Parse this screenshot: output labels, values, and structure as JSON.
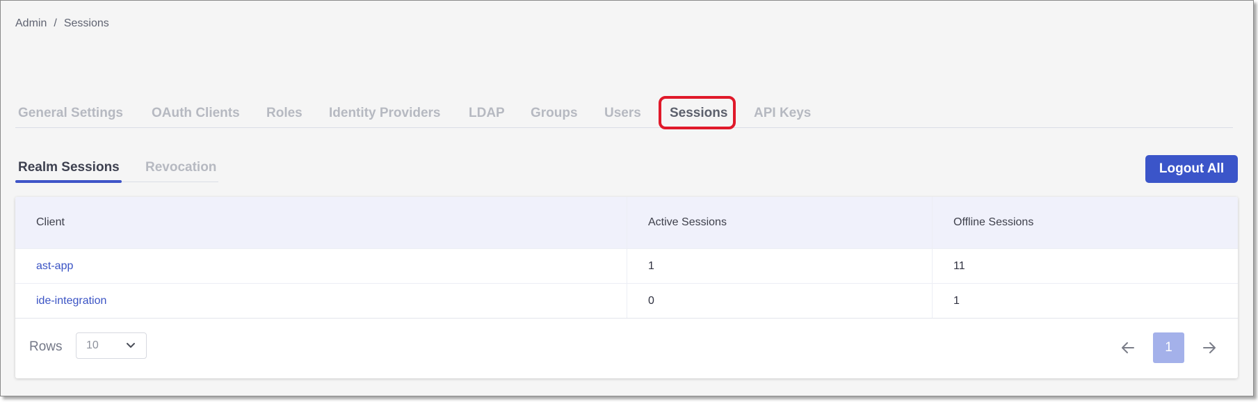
{
  "breadcrumb": {
    "root": "Admin",
    "separator": "/",
    "current": "Sessions"
  },
  "main_tabs": [
    {
      "label": "General Settings"
    },
    {
      "label": "OAuth Clients"
    },
    {
      "label": "Roles"
    },
    {
      "label": "Identity Providers"
    },
    {
      "label": "LDAP"
    },
    {
      "label": "Groups"
    },
    {
      "label": "Users"
    },
    {
      "label": "Sessions",
      "active": true
    },
    {
      "label": "API Keys"
    }
  ],
  "sub_tabs": [
    {
      "label": "Realm Sessions",
      "active": true
    },
    {
      "label": "Revocation"
    }
  ],
  "actions": {
    "logout_all": "Logout All"
  },
  "table": {
    "columns": [
      "Client",
      "Active Sessions",
      "Offline Sessions"
    ],
    "rows": [
      {
        "client": "ast-app",
        "active": "1",
        "offline": "11"
      },
      {
        "client": "ide-integration",
        "active": "0",
        "offline": "1"
      }
    ]
  },
  "pagination": {
    "rows_label": "Rows",
    "rows_value": "10",
    "current_page": "1"
  },
  "colors": {
    "accent": "#3b55c9",
    "highlight": "#e0192a",
    "page_bg": "#f5f5f5"
  },
  "icons": {
    "rows_dropdown": "chevron-down-icon",
    "prev": "arrow-left-icon",
    "next": "arrow-right-icon"
  }
}
